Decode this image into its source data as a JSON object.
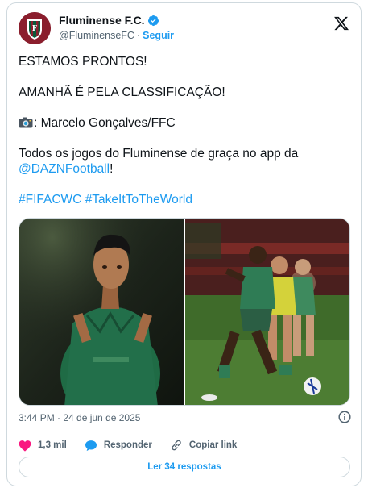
{
  "author": {
    "name": "Fluminense F.C.",
    "handle": "@FluminenseFC",
    "separator": "·",
    "follow_label": "Seguir",
    "verified": true
  },
  "tweet": {
    "line1": "ESTAMOS PRONTOS!",
    "line2": "AMANHÃ É PELA CLASSIFICAÇÃO!",
    "photo_credit": ": Marcelo Gonçalves/FFC",
    "promo_text": "Todos os jogos do Fluminense de graça no app da ",
    "promo_mention": "@DAZNFootball",
    "promo_end": "!",
    "hashtag1": "#FIFACWC",
    "hashtag2": "#TakeItToTheWorld",
    "timestamp": "3:44 PM · 24 de jun de 2025"
  },
  "actions": {
    "likes": "1,3 mil",
    "reply_label": "Responder",
    "copy_link_label": "Copiar link",
    "read_replies_label": "Ler 34 respostas"
  },
  "colors": {
    "accent": "#1d9bf0",
    "like": "#f91880",
    "text": "#0f1419",
    "muted": "#536471"
  },
  "icons": [
    "club-crest-icon",
    "verified-badge-icon",
    "x-logo-icon",
    "camera-icon",
    "info-icon",
    "heart-icon",
    "reply-bubble-icon",
    "link-icon"
  ]
}
